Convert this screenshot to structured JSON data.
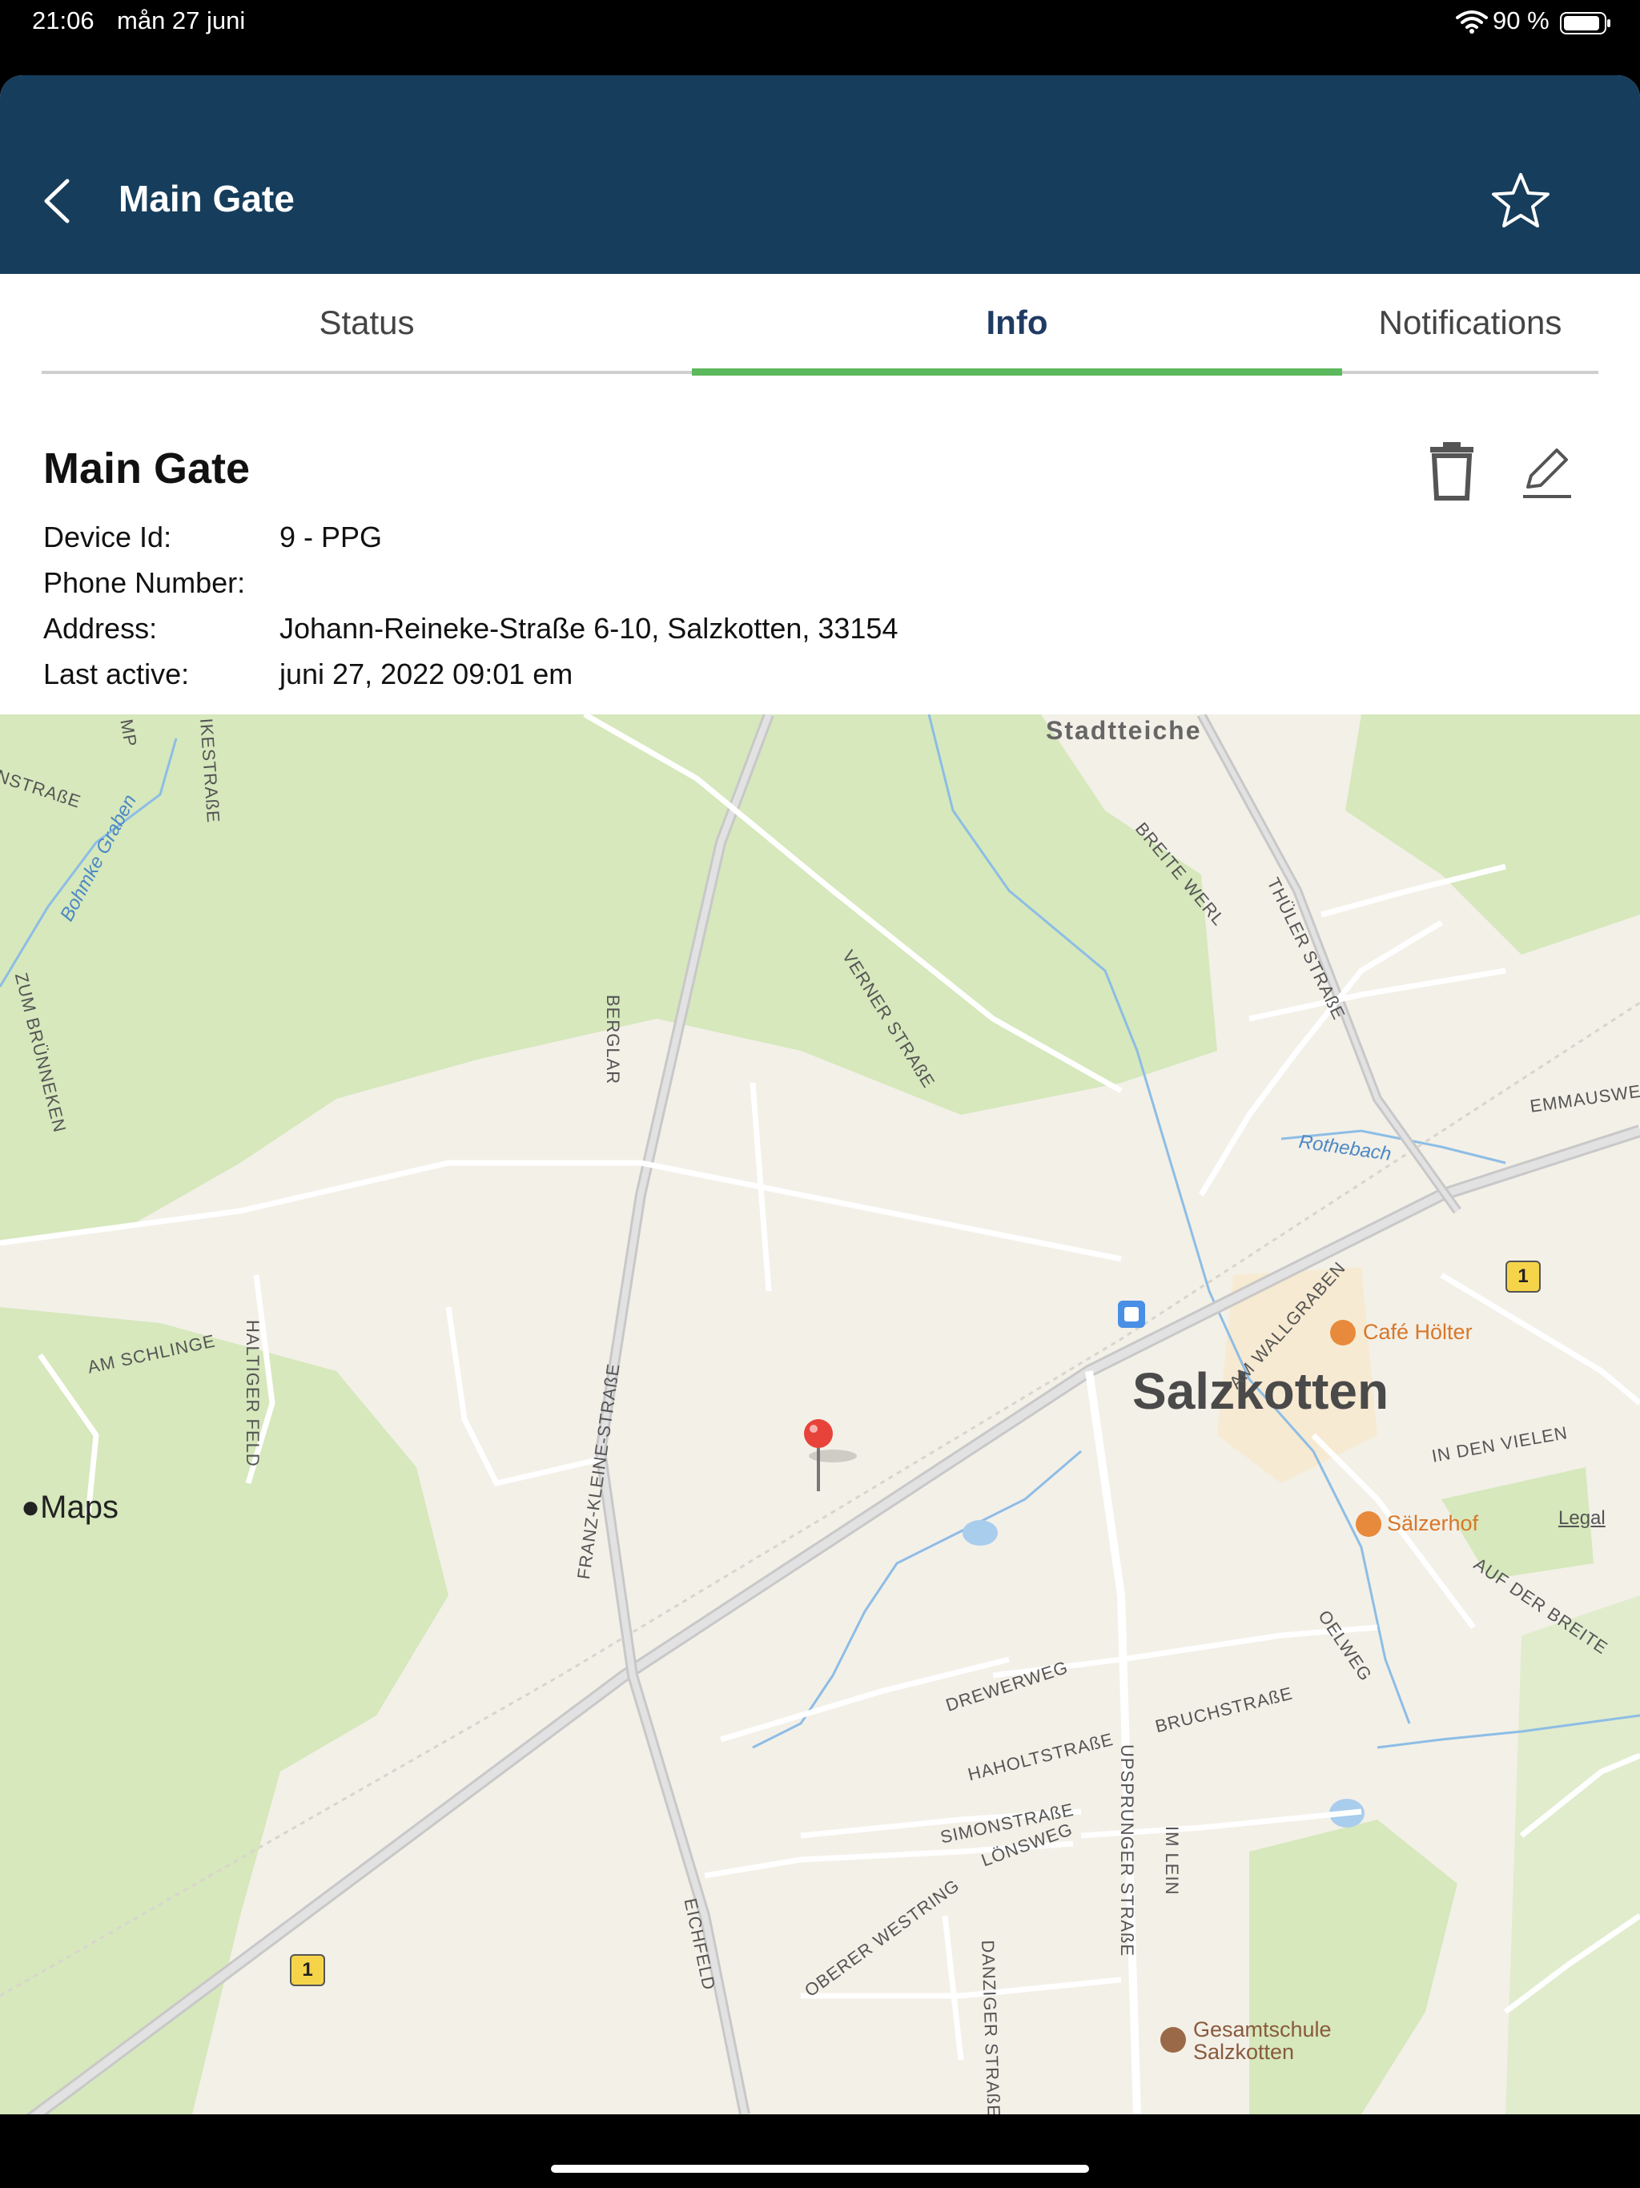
{
  "status_bar": {
    "time": "21:06",
    "date": "mån 27 juni",
    "battery": "90 %"
  },
  "header": {
    "title": "Main Gate"
  },
  "tabs": [
    {
      "label": "Status",
      "selected": false
    },
    {
      "label": "Info",
      "selected": true
    },
    {
      "label": "Notifications",
      "selected": false
    }
  ],
  "device": {
    "name": "Main Gate",
    "fields": [
      {
        "label": "Device Id:",
        "value": "9 - PPG"
      },
      {
        "label": "Phone Number:",
        "value": ""
      },
      {
        "label": "Address:",
        "value": "Johann-Reineke-Straße 6-10, Salzkotten, 33154"
      },
      {
        "label": "Last active:",
        "value": "juni 27, 2022 09:01 em"
      }
    ]
  },
  "map": {
    "city": "Salzkotten",
    "area": "Stadtteiche",
    "streets": {
      "bergslar": "BERGLAR",
      "verner": "VERNER STRAßE",
      "thuler": "THÜLER STRAßE",
      "breite_werl": "BREITE WERL",
      "emmausweg": "EMMAUSWEG",
      "am_schlinge": "AM SCHLINGE",
      "haltiger_feld": "HALTIGER FELD",
      "franz_kleine": "FRANZ-KLEINE-STRAßE",
      "zum_brunneken": "ZUM BRÜNNEKEN",
      "am_wallgraben": "AM WALLGRABEN",
      "in_den_vielen": "IN DEN VIELEN",
      "auf_der_breite": "AUF DER BREITE",
      "oelweg": "OELWEG",
      "drewerweg": "DREWERWEG",
      "haholtstrasse": "HAHOLTSTRAßE",
      "bruchstrasse": "BRUCHSTRAßE",
      "simonstrasse": "SIMONSTRAßE",
      "lonsweg": "LÖNSWEG",
      "upsprunger": "UPSPRUNGER STRAßE",
      "im_lein": "IM LEIN",
      "eichfeld": "EICHFELD",
      "oberer_westring": "OBERER WESTRING",
      "danziger": "DANZIGER STRAßE",
      "ikestrasse": "IKESTRAßE",
      "nstrasse": "NSTRAßE",
      "mp": "MP"
    },
    "water": {
      "bohmke": "Bohmke Graben",
      "rothebach": "Rothebach"
    },
    "pois": {
      "cafe": "Café Hölter",
      "restaurant": "Sälzerhof",
      "school": "Gesamtschule Salzkotten"
    },
    "route_shield": "1",
    "logo": "Maps",
    "legal": "Legal",
    "colors": {
      "land": "#f3f0e8",
      "forest": "#d6e8bc",
      "water": "#a9cdec",
      "road": "#ffffff",
      "major_road": "#c8c8c8",
      "pin": "#e8433a"
    }
  }
}
